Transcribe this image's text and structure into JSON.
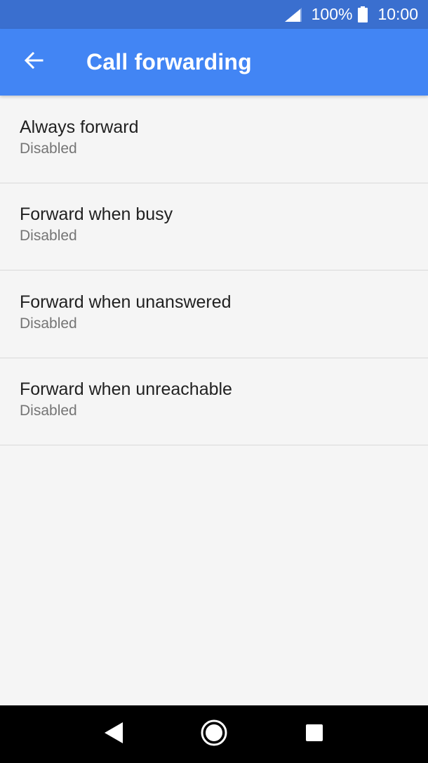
{
  "status_bar": {
    "battery_percent": "100%",
    "time": "10:00",
    "icons": [
      "signal-icon",
      "battery-icon"
    ]
  },
  "app_bar": {
    "title": "Call forwarding",
    "back_icon": "arrow-back-icon",
    "background_color": "#4285f4"
  },
  "list": {
    "items": [
      {
        "title": "Always forward",
        "summary": "Disabled"
      },
      {
        "title": "Forward when busy",
        "summary": "Disabled"
      },
      {
        "title": "Forward when unanswered",
        "summary": "Disabled"
      },
      {
        "title": "Forward when unreachable",
        "summary": "Disabled"
      }
    ]
  },
  "nav_bar": {
    "buttons": [
      "back-triangle-icon",
      "home-circle-icon",
      "recents-square-icon"
    ]
  }
}
